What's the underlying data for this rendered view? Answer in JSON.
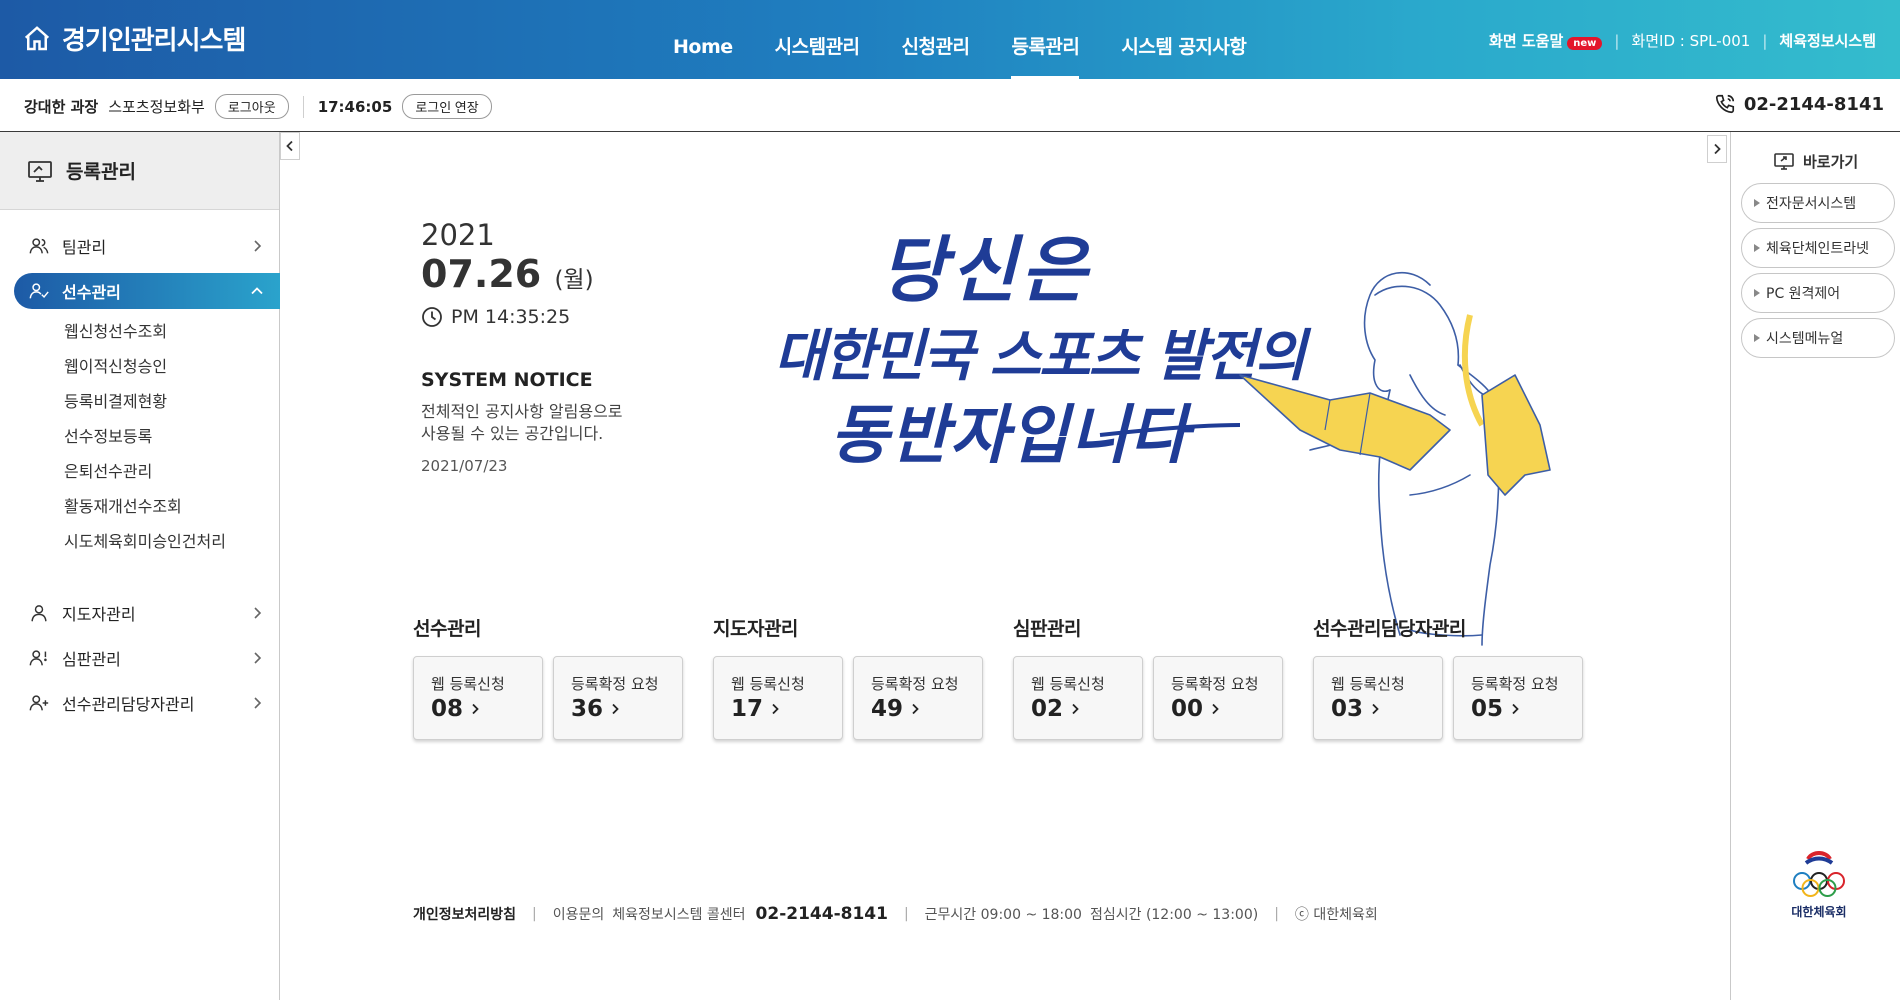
{
  "header": {
    "title": "경기인관리시스템",
    "nav": [
      "Home",
      "시스템관리",
      "신청관리",
      "등록관리",
      "시스템 공지사항"
    ],
    "active_nav": "등록관리",
    "help_label": "화면 도움말",
    "new_badge": "new",
    "screen_id": "화면ID : SPL-001",
    "system_link": "체육정보시스템"
  },
  "userbar": {
    "user_name": "강대한 과장",
    "department": "스포츠정보화부",
    "logout_label": "로그아웃",
    "session_timer": "17:46:05",
    "extend_label": "로그인 연장",
    "phone": "02-2144-8141"
  },
  "sidebar": {
    "title": "등록관리",
    "items": [
      {
        "label": "팀관리",
        "expanded": false
      },
      {
        "label": "선수관리",
        "expanded": true,
        "active": true,
        "children": [
          "웹신청선수조회",
          "웹이적신청승인",
          "등록비결제현황",
          "선수정보등록",
          "은퇴선수관리",
          "활동재개선수조회",
          "시도체육회미승인건처리"
        ]
      },
      {
        "label": "지도자관리",
        "expanded": false
      },
      {
        "label": "심판관리",
        "expanded": false
      },
      {
        "label": "선수관리담당자관리",
        "expanded": false
      }
    ]
  },
  "main": {
    "year": "2021",
    "date": "07.26",
    "day_of_week": "(월)",
    "time": "PM 14:35:25",
    "notice_title": "SYSTEM NOTICE",
    "notice_line1": "전체적인 공지사항 알림용으로",
    "notice_line2": "사용될 수 있는 공간입니다.",
    "notice_date": "2021/07/23",
    "slogan_line1": "당신은",
    "slogan_line2": "대한민국 스포츠 발전의",
    "slogan_line3": "동반자입니다",
    "quick_groups": [
      {
        "title": "선수관리",
        "cards": [
          {
            "label": "웹 등록신청",
            "value": "08"
          },
          {
            "label": "등록확정 요청",
            "value": "36"
          }
        ]
      },
      {
        "title": "지도자관리",
        "cards": [
          {
            "label": "웹 등록신청",
            "value": "17"
          },
          {
            "label": "등록확정 요청",
            "value": "49"
          }
        ]
      },
      {
        "title": "심판관리",
        "cards": [
          {
            "label": "웹 등록신청",
            "value": "02"
          },
          {
            "label": "등록확정 요청",
            "value": "00"
          }
        ]
      },
      {
        "title": "선수관리담당자관리",
        "cards": [
          {
            "label": "웹 등록신청",
            "value": "03"
          },
          {
            "label": "등록확정 요청",
            "value": "05"
          }
        ]
      }
    ]
  },
  "footer": {
    "privacy": "개인정보처리방침",
    "inquiry": "이용문의",
    "callcenter": "체육정보시스템 콜센터",
    "phone": "02-2144-8141",
    "hours": "근무시간 09:00 ~ 18:00",
    "lunch": "점심시간 (12:00 ~ 13:00)",
    "copyright": "ⓒ 대한체육회"
  },
  "right_panel": {
    "title": "바로가기",
    "links": [
      "전자문서시스템",
      "체육단체인트라넷",
      "PC 원격제어",
      "시스템메뉴얼"
    ],
    "org_name": "대한체육회"
  },
  "colors": {
    "header_start": "#1d5aa6",
    "header_end": "#34bccd",
    "slogan": "#1f3c96",
    "accent_yellow": "#f6d451"
  }
}
